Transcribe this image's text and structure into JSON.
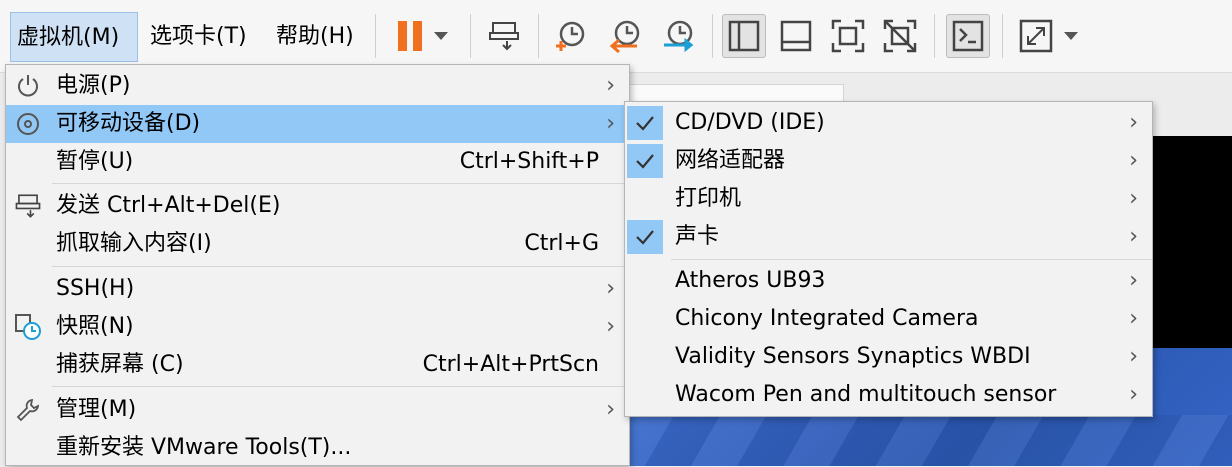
{
  "menubar": {
    "vm": "虚拟机(M)",
    "tabs": "选项卡(T)",
    "help": "帮助(H)"
  },
  "toolbar": {
    "icons": [
      "pause-icon",
      "dropdown-icon",
      "send-cad-icon",
      "snapshot-take-icon",
      "snapshot-revert-icon",
      "snapshot-manager-icon",
      "library-view-icon",
      "console-view-icon",
      "fullscreen-icon",
      "unity-icon",
      "terminal-icon",
      "stretch-icon"
    ]
  },
  "main_menu": {
    "items": [
      {
        "label": "电源(P)",
        "accel": "",
        "icon": "power-icon",
        "submenu": true
      },
      {
        "label": "可移动设备(D)",
        "accel": "",
        "icon": "disc-icon",
        "submenu": true,
        "highlighted": true
      },
      {
        "label": "暂停(U)",
        "accel": "Ctrl+Shift+P",
        "icon": "",
        "submenu": false
      },
      {
        "label": "发送 Ctrl+Alt+Del(E)",
        "accel": "",
        "icon": "send-cad-icon",
        "submenu": false
      },
      {
        "label": "抓取输入内容(I)",
        "accel": "Ctrl+G",
        "icon": "",
        "submenu": false
      },
      {
        "label": "SSH(H)",
        "accel": "",
        "icon": "",
        "submenu": true
      },
      {
        "label": "快照(N)",
        "accel": "",
        "icon": "snapshot-icon",
        "submenu": true
      },
      {
        "label": "捕获屏幕 (C)",
        "accel": "Ctrl+Alt+PrtScn",
        "icon": "",
        "submenu": false
      },
      {
        "label": "管理(M)",
        "accel": "",
        "icon": "wrench-icon",
        "submenu": true
      },
      {
        "label": "重新安装 VMware Tools(T)...",
        "accel": "",
        "icon": "",
        "submenu": false
      }
    ]
  },
  "sub_menu": {
    "items": [
      {
        "label": "CD/DVD (IDE)",
        "checked": true
      },
      {
        "label": "网络适配器",
        "checked": true
      },
      {
        "label": "打印机",
        "checked": false
      },
      {
        "label": "声卡",
        "checked": true
      },
      {
        "label": "Atheros UB93",
        "checked": false
      },
      {
        "label": "Chicony Integrated Camera",
        "checked": false
      },
      {
        "label": "Validity Sensors Synaptics WBDI",
        "checked": false
      },
      {
        "label": "Wacom Pen and multitouch sensor",
        "checked": false
      }
    ]
  },
  "colors": {
    "highlight": "#92c8f5",
    "accent_orange": "#f07020",
    "accent_teal": "#1a9fd6"
  }
}
